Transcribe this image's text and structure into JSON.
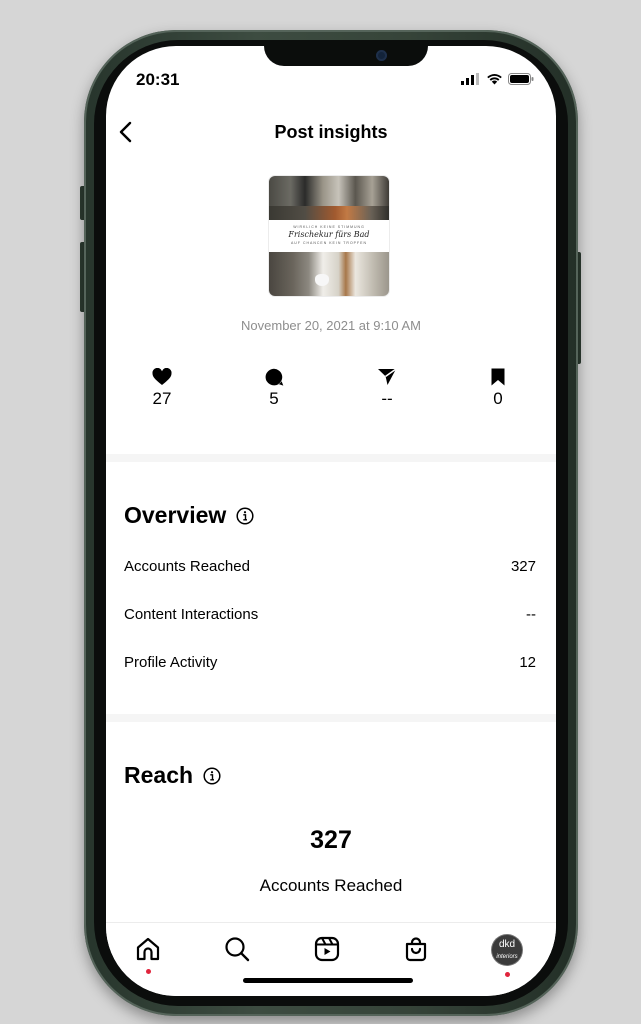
{
  "status_bar": {
    "time": "20:31"
  },
  "header": {
    "title": "Post insights"
  },
  "post": {
    "thumbnail_caption_small": "WIRKLICH KEINE STIMMUNG",
    "thumbnail_caption_script": "Frischekur fürs Bad",
    "thumbnail_caption_bottom": "AUF CHANCEN KEIN TROPFEN",
    "date": "November 20, 2021 at 9:10 AM"
  },
  "stats": [
    {
      "icon": "heart-icon",
      "value": "27"
    },
    {
      "icon": "comment-icon",
      "value": "5"
    },
    {
      "icon": "share-icon",
      "value": "--"
    },
    {
      "icon": "bookmark-icon",
      "value": "0"
    }
  ],
  "overview": {
    "title": "Overview",
    "rows": [
      {
        "label": "Accounts Reached",
        "value": "327"
      },
      {
        "label": "Content Interactions",
        "value": "--"
      },
      {
        "label": "Profile Activity",
        "value": "12"
      }
    ]
  },
  "reach": {
    "title": "Reach",
    "number": "327",
    "caption": "Accounts Reached"
  },
  "tabbar": {
    "items": [
      "home-icon",
      "search-icon",
      "reels-icon",
      "shop-icon",
      "profile-avatar"
    ],
    "avatar_initials": "dkd",
    "avatar_sub": "interiors"
  },
  "colors": {
    "notification_dot": "#e0243c",
    "muted_text": "#8e8e8e",
    "frame": "#364439"
  }
}
